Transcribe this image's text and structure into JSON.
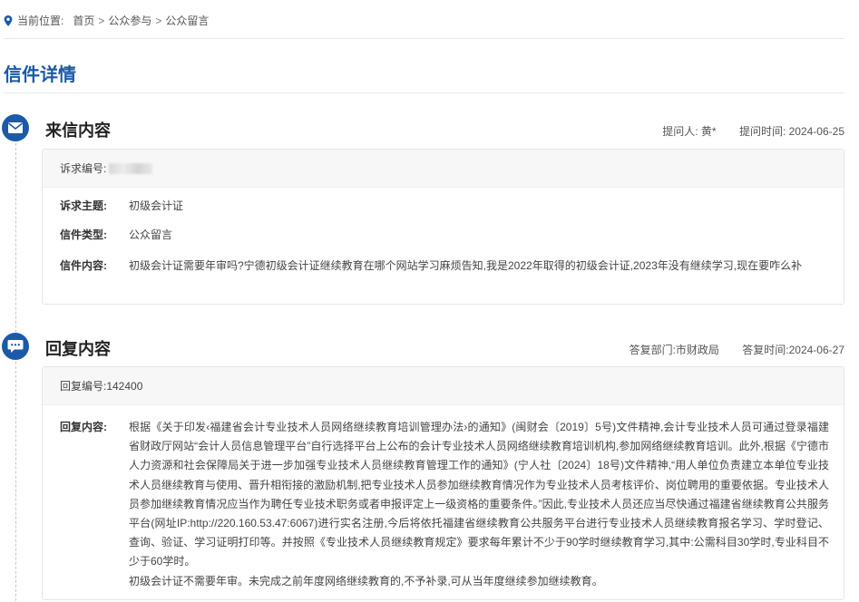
{
  "breadcrumb": {
    "label": "当前位置:",
    "items": [
      "首页",
      "公众参与",
      "公众留言"
    ],
    "separator": ">"
  },
  "page_title": "信件详情",
  "letter": {
    "section_title": "来信内容",
    "icon": "envelope-icon",
    "asker": "提问人: 黄*",
    "ask_time": "提问时间: 2024-06-25",
    "appeal_no_label": "诉求编号:",
    "subject_label": "诉求主题:",
    "subject": "初级会计证",
    "type_label": "信件类型:",
    "type": "公众留言",
    "content_label": "信件内容:",
    "content": "初级会计证需要年审吗?宁德初级会计证继续教育在哪个网站学习麻烦告知,我是2022年取得的初级会计证,2023年没有继续学习,现在要咋么补"
  },
  "reply": {
    "section_title": "回复内容",
    "icon": "chat-bubble-icon",
    "department": "答复部门:市财政局",
    "reply_time": "答复时间:2024-06-27",
    "reply_no": "回复编号:142400",
    "content_label": "回复内容:",
    "content_p1": "根据《关于印发‹福建省会计专业技术人员网络继续教育培训管理办法›的通知》(闽财会〔2019〕5号)文件精神,会计专业技术人员可通过登录福建省财政厅网站“会计人员信息管理平台”自行选择平台上公布的会计专业技术人员网络继续教育培训机构,参加网络继续教育培训。此外,根据《宁德市人力资源和社会保障局关于进一步加强专业技术人员继续教育管理工作的通知》(宁人社〔2024〕18号)文件精神,“用人单位负责建立本单位专业技术人员继续教育与使用、晋升相衔接的激励机制,把专业技术人员参加继续教育情况作为专业技术人员考核评价、岗位聘用的重要依据。专业技术人员参加继续教育情况应当作为聘任专业技术职务或者申报评定上一级资格的重要条件。”因此,专业技术人员还应当尽快通过福建省继续教育公共服务平台(网址IP:http://220.160.53.47:6067)进行实名注册,今后将依托福建省继续教育公共服务平台进行专业技术人员继续教育报名学习、学时登记、查询、验证、学习证明打印等。并按照《专业技术人员继续教育规定》要求每年累计不少于90学时继续教育学习,其中:公需科目30学时,专业科目不少于60学时。",
    "content_p2": "初级会计证不需要年审。未完成之前年度网络继续教育的,不予补录,可从当年度继续参加继续教育。"
  },
  "colors": {
    "accent": "#1b5aa8",
    "card_head_bg": "#f7f7f7",
    "border": "#e6e6e6"
  }
}
